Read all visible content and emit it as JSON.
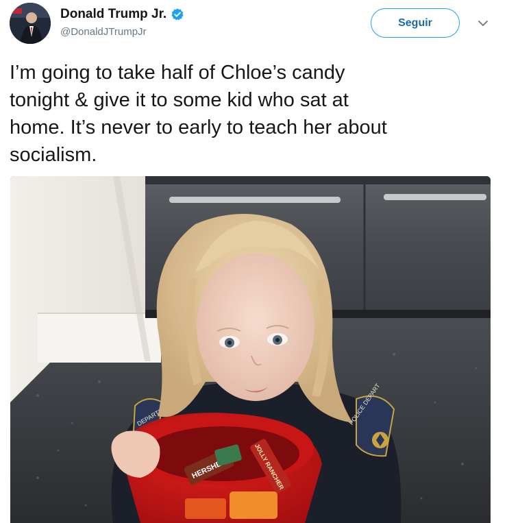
{
  "author": {
    "name": "Donald Trump Jr.",
    "handle": "@DonaldJTrumpJr",
    "verified": true,
    "verified_color": "#1da1f2"
  },
  "actions": {
    "follow_label": "Seguir",
    "accent_color": "#1da1f2"
  },
  "tweet": {
    "text": "I’m going to take half of Chloe’s candy\ntonight & give it to some kid who sat at\nhome. It’s never to early to teach her about\nsocialism."
  },
  "media": {
    "labels": {
      "patch_left": "DEPARTMENT",
      "patch_right": "POLICE DEPART",
      "candy_1": "HERSHEY'S",
      "candy_2": "JOLLY RANCHER"
    }
  }
}
